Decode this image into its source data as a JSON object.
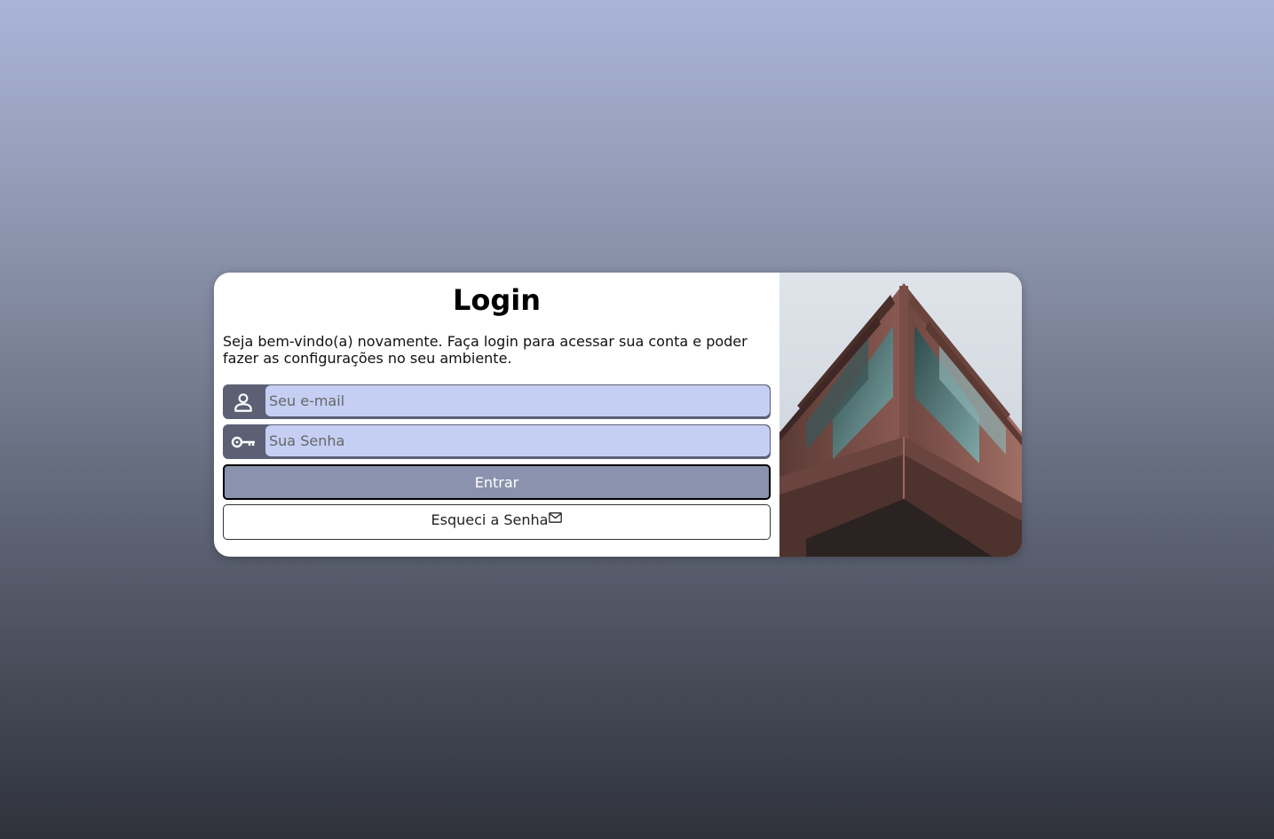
{
  "login": {
    "title": "Login",
    "welcome": "Seja bem-vindo(a) novamente. Faça login para acessar sua conta e poder fazer as configurações no seu ambiente.",
    "email_placeholder": "Seu e-mail",
    "password_placeholder": "Sua Senha",
    "submit_label": "Entrar",
    "forgot_label": "Esqueci a Senha",
    "icons": {
      "email": "person-icon",
      "password": "key-icon",
      "forgot": "envelope-icon"
    }
  },
  "colors": {
    "input_bg": "#c5cff3",
    "icon_box": "#5b6075",
    "submit_bg": "#8a92ad"
  }
}
